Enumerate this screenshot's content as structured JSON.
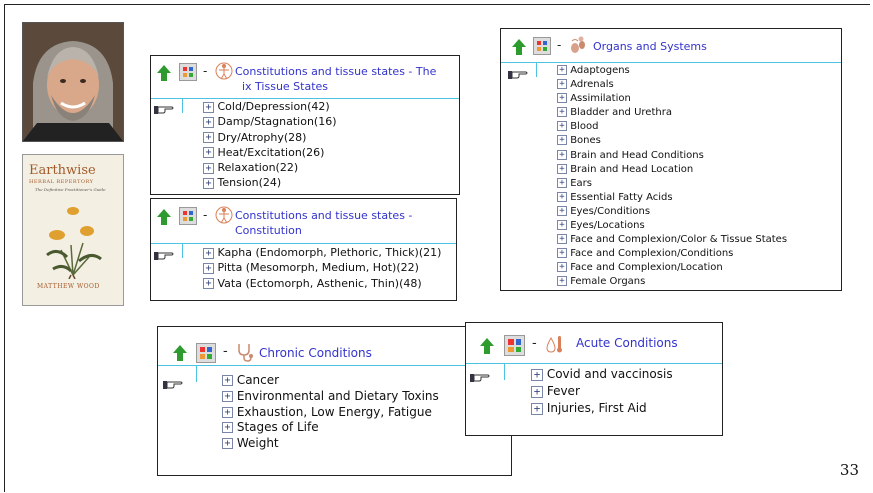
{
  "page_number": "33",
  "book": {
    "title": "Earthwise",
    "subtitle": "HERBAL REPERTORY",
    "tagline": "The Definitive Practitioner's Guide",
    "author": "MATTHEW WOOD"
  },
  "panels": {
    "six_tissue": {
      "title": "Constitutions and tissue states - The Six Tissue States",
      "items": [
        "Cold/Depression(42)",
        "Damp/Stagnation(16)",
        "Dry/Atrophy(28)",
        "Heat/Excitation(26)",
        "Relaxation(22)",
        "Tension(24)"
      ]
    },
    "constitution": {
      "title": "Constitutions and tissue states - Constitution",
      "items": [
        "Kapha (Endomorph, Plethoric, Thick)(21)",
        "Pitta (Mesomorph, Medium, Hot)(22)",
        "Vata (Ectomorph, Asthenic, Thin)(48)"
      ]
    },
    "organs": {
      "title": "Organs and Systems",
      "items": [
        "Adaptogens",
        "Adrenals",
        "Assimilation",
        "Bladder and Urethra",
        "Blood",
        "Bones",
        "Brain and Head Conditions",
        "Brain and Head Location",
        "Ears",
        "Essential Fatty Acids",
        "Eyes/Conditions",
        "Eyes/Locations",
        "Face and Complexion/Color & Tissue States",
        "Face and Complexion/Conditions",
        "Face and Complexion/Location",
        "Female Organs"
      ]
    },
    "chronic": {
      "title": "Chronic Conditions",
      "items": [
        "Cancer",
        "Environmental and Dietary Toxins",
        "Exhaustion, Low Energy, Fatigue",
        "Stages of Life",
        "Weight"
      ]
    },
    "acute": {
      "title": "Acute Conditions",
      "items": [
        "Covid and vaccinosis",
        "Fever",
        "Injuries, First Aid"
      ]
    }
  },
  "labels": {
    "dash": "-",
    "expand": "+"
  }
}
